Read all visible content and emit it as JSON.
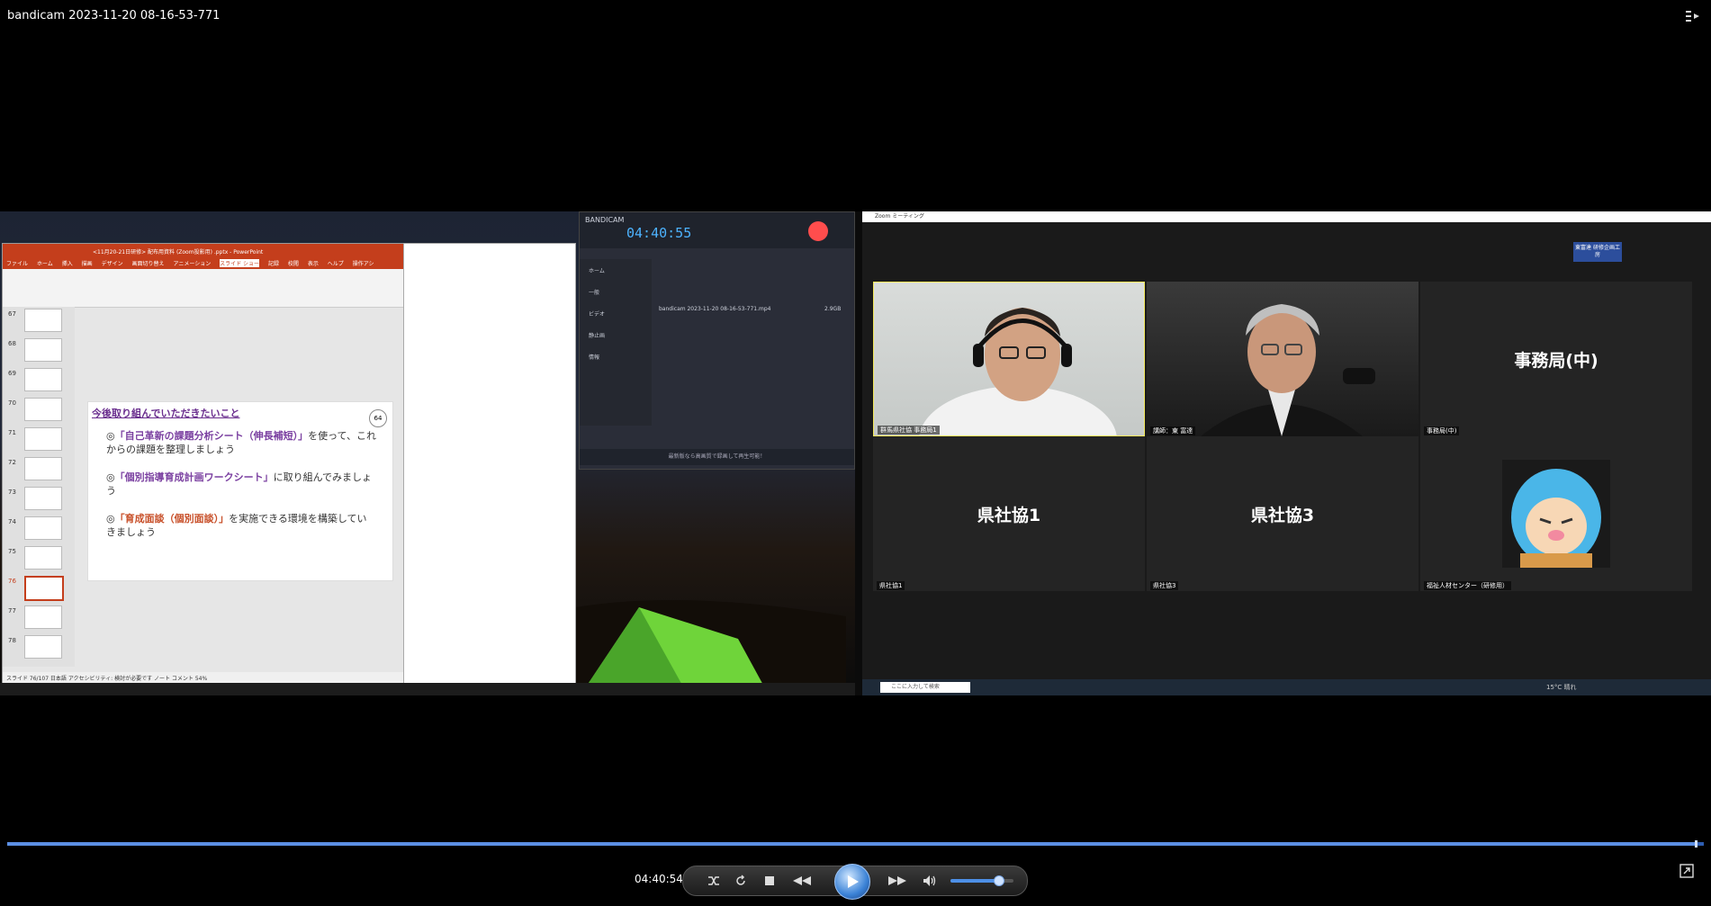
{
  "title": "bandicam 2023-11-20 08-16-53-771",
  "powerpoint": {
    "title": "<11月20-21日研修> 配布用資料 (Zoom投影用) .pptx - PowerPoint",
    "tabs": [
      "ファイル",
      "ホーム",
      "挿入",
      "描画",
      "デザイン",
      "画面切り替え",
      "アニメーション",
      "スライド ショー",
      "記録",
      "校閲",
      "表示",
      "ヘルプ",
      "操作アシ"
    ],
    "thumb_numbers": [
      "67",
      "68",
      "69",
      "70",
      "71",
      "72",
      "73",
      "74",
      "75",
      "76",
      "77",
      "78"
    ],
    "slide": {
      "heading": "今後取り組んでいただきたいこと",
      "number": "64",
      "b1_mark": "◎",
      "b1_hl": "「自己革新の課題分析シート（伸長補短）」",
      "b1_rest": "を使って、これからの課題を整理しましょう",
      "b2_mark": "◎",
      "b2_hl": "「個別指導育成計画ワークシート」",
      "b2_rest": "に取り組んでみましょう",
      "b3_mark": "◎",
      "b3_hl": "「育成面談（個別面談）」",
      "b3_rest": "を実施できる環境を構築していきましょう"
    },
    "status": "スライド 76/107   日本語   アクセシビリティ: 検討が必要です   ノート   コメント   54%"
  },
  "bandicam": {
    "logo": "BANDICAM",
    "timer": "04:40:55",
    "sidebar": [
      "ホーム",
      "一般",
      "ビデオ",
      "静止画",
      "情報"
    ],
    "file_name": "bandicam 2023-11-20 08-16-53-771.mp4",
    "file_size": "2.9GB",
    "footer": "最新版なら高画質で録画して再生可能！"
  },
  "zoom": {
    "window_title": "Zoom ミーティング",
    "badge": "東富達 研修企画工房",
    "tiles": [
      {
        "label": "",
        "name": "群馬県社協 事務局1"
      },
      {
        "label": "",
        "name": "講師：東 富達"
      },
      {
        "label": "事務局(中)",
        "name": "事務局(中)"
      },
      {
        "label": "県社協1",
        "name": "県社協1"
      },
      {
        "label": "県社協3",
        "name": "県社協3"
      },
      {
        "label": "",
        "name": "福祉人材センター（研修用）"
      }
    ],
    "search_placeholder": "ここに入力して検索",
    "weather": "15°C 晴れ"
  },
  "player": {
    "time": "04:40:54",
    "progress_fraction": 0.995,
    "volume_fraction": 0.75
  },
  "colors": {
    "accent": "#3b82d6",
    "powerpoint_red": "#c43e1c",
    "zoom_active_border": "#f2e85a",
    "record_red": "#ff4d4d"
  }
}
